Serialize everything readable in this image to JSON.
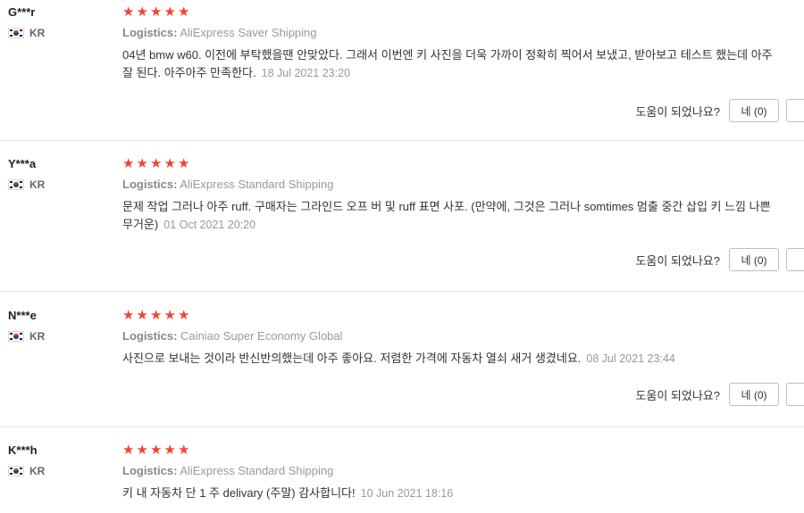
{
  "helpful_question": "도움이 되었나요?",
  "logistics_label": "Logistics:",
  "star_glyph": "★",
  "reviews": [
    {
      "user": "G***r",
      "country": "KR",
      "rating": 5,
      "shipping": "AliExpress Saver Shipping",
      "text": "04년 bmw w60. 이전에 부탁했을땐 안맞았다. 그래서 이번엔 키 사진을 더욱 가까이 정확히 찍어서 보냈고, 받아보고 테스트 했는데 아주 잘 된다. 아주아주 만족한다.",
      "date": "18 Jul 2021 23:20",
      "yes_label": "네 (0)"
    },
    {
      "user": "Y***a",
      "country": "KR",
      "rating": 5,
      "shipping": "AliExpress Standard Shipping",
      "text": "문제 작업 그러나 아주 ruff. 구매자는 그라인드 오프 버 및 ruff 표면 사포. (만약에, 그것은 그러나 somtimes 멈출 중간 삽입 키 느낌 나쁜 무거운)",
      "date": "01 Oct 2021 20:20",
      "yes_label": "네 (0)"
    },
    {
      "user": "N***e",
      "country": "KR",
      "rating": 5,
      "shipping": "Cainiao Super Economy Global",
      "text": "사진으로 보내는 것이라 반신반의했는데 아주 좋아요. 저렴한 가격에 자동차 열쇠 새거 생겼네요.",
      "date": "08 Jul 2021 23:44",
      "yes_label": "네 (0)"
    },
    {
      "user": "K***h",
      "country": "KR",
      "rating": 5,
      "shipping": "AliExpress Standard Shipping",
      "text": "키 내 자동차 단 1 주 delivary (주말) 감사합니다!",
      "date": "10 Jun 2021 18:16",
      "yes_label": "네 (0)"
    }
  ],
  "colors": {
    "star": "#f44336",
    "muted": "#999999",
    "border": "#bfbfbf"
  }
}
